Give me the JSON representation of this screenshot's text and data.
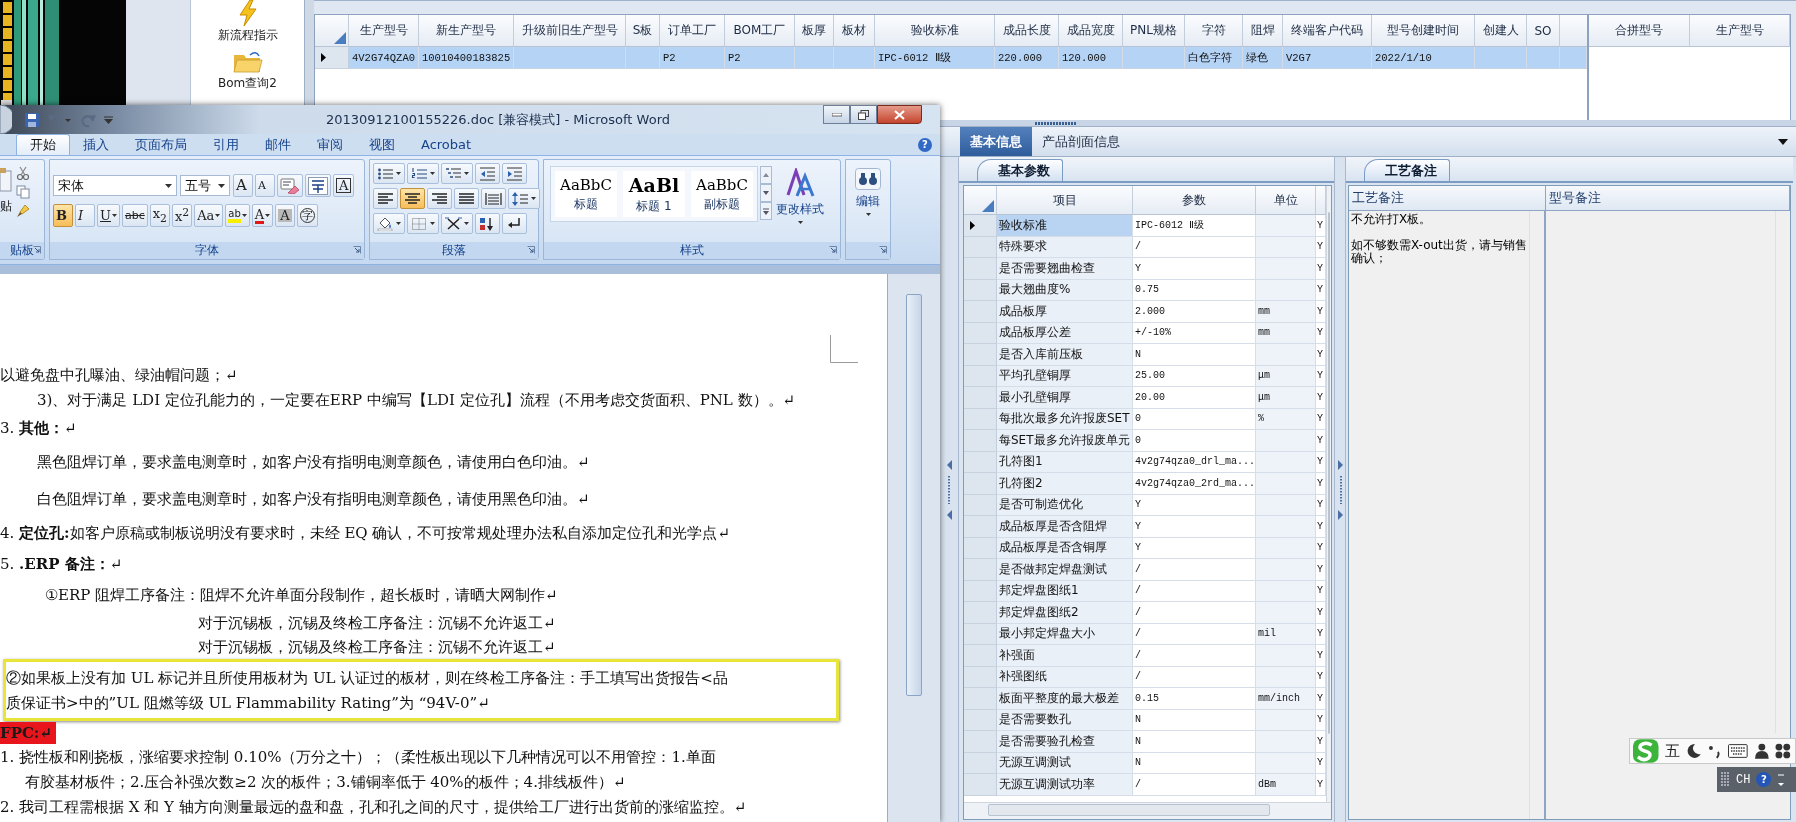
{
  "app": {
    "sidebar": [
      {
        "label": "新流程指示"
      },
      {
        "label": "Bom查询2"
      }
    ],
    "main_grid": {
      "columns": [
        "生产型号",
        "新生产型号",
        "升级前旧生产型号",
        "S板",
        "订单工厂",
        "BOM工厂",
        "板厚",
        "板材",
        "验收标准",
        "成品长度",
        "成品宽度",
        "PNL规格",
        "字符",
        "阻焊",
        "终端客户代码",
        "型号创建时间",
        "创建人",
        "SO"
      ],
      "rows": [
        {
          "selected": true,
          "cells": [
            "4V2G74QZA0",
            "10010400183825",
            null,
            null,
            "P2",
            "P2",
            null,
            null,
            "IPC-6012 Ⅱ级",
            "220.000",
            "120.000",
            null,
            "白色字符",
            "绿色",
            "V2G7",
            "2022/1/10",
            null,
            null
          ]
        }
      ]
    },
    "merge_grid": {
      "columns": [
        "合拼型号",
        "生产型号"
      ]
    },
    "detail_tabs": [
      {
        "label": "基本信息",
        "selected": true
      },
      {
        "label": "产品剖面信息",
        "selected": false
      }
    ],
    "params": {
      "tab": "基本参数",
      "columns": [
        "项目",
        "参数",
        "单位"
      ],
      "rows": [
        {
          "item": "验收标准",
          "value": "IPC-6012 Ⅱ级",
          "column_4": "Y",
          "selected": true
        },
        {
          "item": "特殊要求",
          "value": "/",
          "column_4": "Y",
          "selected": false
        },
        {
          "item": "是否需要翘曲检查",
          "value": "Y",
          "column_4": "Y",
          "selected": false
        },
        {
          "item": "最大翘曲度%",
          "value": "0.75",
          "column_4": "Y",
          "selected": false
        },
        {
          "item": "成品板厚",
          "value": "2.000",
          "unit": "mm",
          "column_4": "Y",
          "selected": false
        },
        {
          "item": "成品板厚公差",
          "value": "+/-10%",
          "unit": "mm",
          "column_4": "Y",
          "selected": false
        },
        {
          "item": "是否入库前压板",
          "value": "N",
          "column_4": "Y",
          "selected": false
        },
        {
          "item": "平均孔壁铜厚",
          "value": "25.00",
          "unit": "μm",
          "column_4": "Y",
          "selected": false
        },
        {
          "item": "最小孔壁铜厚",
          "value": "20.00",
          "unit": "μm",
          "column_4": "Y",
          "selected": false
        },
        {
          "item": "每批次最多允许报废SET",
          "value": "0",
          "unit": "%",
          "column_4": "Y",
          "selected": false
        },
        {
          "item": "每SET最多允许报废单元",
          "value": "0",
          "column_4": "Y",
          "selected": false
        },
        {
          "item": "孔符图1",
          "value": "4v2g74qza0_drl_ma...",
          "column_4": "Y",
          "selected": false
        },
        {
          "item": "孔符图2",
          "value": "4v2g74qza0_2rd_ma...",
          "column_4": "Y",
          "selected": false
        },
        {
          "item": "是否可制造优化",
          "value": "Y",
          "column_4": "Y",
          "selected": false
        },
        {
          "item": "成品板厚是否含阻焊",
          "value": "Y",
          "column_4": "Y",
          "selected": false
        },
        {
          "item": "成品板厚是否含铜厚",
          "value": "Y",
          "column_4": "Y",
          "selected": false
        },
        {
          "item": "是否做邦定焊盘测试",
          "value": "/",
          "column_4": "Y",
          "selected": false
        },
        {
          "item": "邦定焊盘图纸1",
          "value": "/",
          "column_4": "Y",
          "selected": false
        },
        {
          "item": "邦定焊盘图纸2",
          "value": "/",
          "column_4": "Y",
          "selected": false
        },
        {
          "item": "最小邦定焊盘大小",
          "value": "/",
          "unit": "mil",
          "column_4": "Y",
          "selected": false
        },
        {
          "item": "补强面",
          "value": "/",
          "column_4": "Y",
          "selected": false
        },
        {
          "item": "补强图纸",
          "value": "/",
          "column_4": "Y",
          "selected": false
        },
        {
          "item": "板面平整度的最大极差",
          "value": "0.15",
          "unit": "mm/inch",
          "column_4": "Y",
          "selected": false
        },
        {
          "item": "是否需要数孔",
          "value": "N",
          "column_4": "Y",
          "selected": false
        },
        {
          "item": "是否需要验孔检查",
          "value": "N",
          "column_4": "Y",
          "selected": false
        },
        {
          "item": "无源互调测试",
          "value": "N",
          "column_4": "Y",
          "selected": false
        },
        {
          "item": "无源互调测试功率",
          "value": "/",
          "unit": "dBm",
          "column_4": "Y",
          "selected": false
        }
      ]
    },
    "notes": {
      "tab": "工艺备注",
      "columns": [
        "工艺备注",
        "型号备注"
      ],
      "process_note": [
        "不允许打X板。",
        "如不够数需X-out出货，请与销售确认；"
      ]
    }
  },
  "word": {
    "title": "20130912100155226.doc [兼容模式] - Microsoft Word",
    "help": "?",
    "tabs": [
      {
        "label": "开始",
        "selected": true
      },
      {
        "label": "插入",
        "selected": false
      },
      {
        "label": "页面布局",
        "selected": false
      },
      {
        "label": "引用",
        "selected": false
      },
      {
        "label": "邮件",
        "selected": false
      },
      {
        "label": "审阅",
        "selected": false
      },
      {
        "label": "视图",
        "selected": false
      },
      {
        "label": "Acrobat",
        "selected": false
      }
    ],
    "ribbon": {
      "clipboard": {
        "paste": "贴",
        "label": "贴板"
      },
      "font": {
        "name": "宋体",
        "size": "五号",
        "label": "字体",
        "row1": [
          {
            "kind": "grow",
            "text": "A",
            "on": false
          },
          {
            "kind": "shrink",
            "text": "A",
            "on": false
          },
          {
            "kind": "clear",
            "on": false
          },
          {
            "kind": "phonetic",
            "on": false
          },
          {
            "kind": "border",
            "text": "A",
            "on": false
          }
        ],
        "row2": [
          {
            "kind": "bold",
            "text": "B",
            "on": true
          },
          {
            "kind": "italic",
            "text": "I",
            "on": false
          },
          {
            "kind": "underline",
            "text": "U",
            "on": false
          },
          {
            "kind": "strike",
            "text": "abc",
            "on": false
          },
          {
            "kind": "sub",
            "text": "x$_{2}$",
            "on": false
          },
          {
            "kind": "sup",
            "text": "x$^{2}$",
            "on": false
          },
          {
            "kind": "case",
            "text": "Aa",
            "on": false
          },
          {
            "kind": "highlight",
            "text": "ab",
            "on": false
          },
          {
            "kind": "color",
            "text": "A",
            "on": false
          },
          {
            "kind": "shade",
            "text": "A",
            "on": false
          },
          {
            "kind": "enclose",
            "text": "字",
            "on": false
          }
        ]
      },
      "paragraph": {
        "label": "段落",
        "rows": [
          [
            {
              "kind": "bullets",
              "on": false
            },
            {
              "kind": "numbering",
              "on": false
            },
            {
              "kind": "multilevel",
              "on": false
            },
            {
              "kind": "outdent",
              "on": false
            },
            {
              "kind": "indent",
              "on": false
            }
          ],
          [
            {
              "kind": "left",
              "on": false
            },
            {
              "kind": "center",
              "on": true
            },
            {
              "kind": "right",
              "on": false
            },
            {
              "kind": "justify",
              "on": false
            },
            {
              "kind": "distribute",
              "on": false
            },
            {
              "kind": "spacing",
              "on": false
            }
          ],
          [
            {
              "kind": "shading",
              "on": false
            },
            {
              "kind": "borders",
              "on": false
            },
            {
              "kind": "asian",
              "on": false
            },
            {
              "kind": "sort",
              "on": false
            },
            {
              "kind": "marks",
              "on": false
            }
          ]
        ]
      },
      "styles": {
        "label": "样式",
        "change": "更改样式",
        "items": [
          {
            "sample": "AaBbC",
            "label": "标题"
          },
          {
            "sample": "AaBl",
            "label": "标题 1"
          },
          {
            "sample": "AaBbC",
            "label": "副标题"
          }
        ]
      },
      "editing": {
        "label": "编辑"
      }
    },
    "document": [
      {
        "kind": "plain",
        "text": "以避免盘中孔曝油、绿油帽问题；↵"
      },
      {
        "kind": "indent",
        "text": "3)、对于满足 LDI 定位孔能力的，一定要在ERP 中编写【LDI 定位孔】流程（不用考虑交货面积、PNL 数）。↵"
      },
      {
        "kind": "heading",
        "text": "3. **其他：**↵"
      },
      {
        "kind": "spaced",
        "text": "黑色阻焊订单，要求盖电测章时，如客户没有指明电测章颜色，请使用白色印油。↵"
      },
      {
        "kind": "spaced",
        "text": "白色阻焊订单，要求盖电测章时，如客户没有指明电测章颜色，请使用黑色印油。↵"
      },
      {
        "kind": "heading",
        "text": "4. **定位孔:**如客户原稿或制板说明没有要求时，未经 EQ 确认，不可按常规处理办法私自添加定位孔和光学点↵"
      },
      {
        "kind": "heading",
        "text": "5. **.ERP 备注：**↵"
      },
      {
        "kind": "sub",
        "text": "①ERP 阻焊工序备注：阻焊不允许单面分段制作，超长板时，请晒大网制作↵"
      },
      {
        "kind": "deep",
        "text": "对于沉锡板，沉锡及终检工序备注：沉锡不允许返工↵"
      },
      {
        "kind": "deep",
        "text": "对于沉锡板，沉锡及终检工序备注：沉锡不允许返工↵"
      },
      {
        "kind": "note",
        "lines": [
          "②如果板上没有加 UL 标记并且所使用板材为 UL 认证过的板材，则在终检工序备注：手工填写出货报告<品",
          "质保证书>中的”UL 阻燃等级 UL Flammability Rating”为 “94V-0”↵"
        ]
      },
      {
        "kind": "tag",
        "text": "FPC:↵"
      },
      {
        "kind": "numbered",
        "text": "1.  挠性板和刚挠板，涨缩要求控制 0.10%（万分之十）；（柔性板出现以下几种情况可以不用管控：1.单面"
      },
      {
        "kind": "cont",
        "text": "有胶基材板件；2.压合补强次数≥2 次的板件；3.铺铜率低于 40%的板件；4.排线板件）↵"
      },
      {
        "kind": "numbered",
        "text": "2.  我司工程需根据 X 和 Y 轴方向测量最远的盘和盘，孔和孔之间的尺寸，提供给工厂进行出货前的涨缩监控。↵"
      }
    ]
  },
  "ime": {
    "mode": "五",
    "lang": "CH",
    "help": "?"
  }
}
